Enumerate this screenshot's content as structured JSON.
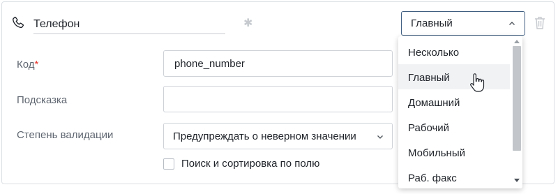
{
  "field": {
    "name_value": "Телефон",
    "type_selected": "Главный"
  },
  "rows": {
    "code": {
      "label": "Код",
      "required_mark": "*",
      "value": "phone_number"
    },
    "hint": {
      "label": "Подсказка",
      "value": ""
    },
    "validation": {
      "label": "Степень валидации",
      "selected": "Предупреждать о неверном значении"
    },
    "search": {
      "label": "Поиск и сортировка по полю",
      "checked": false
    }
  },
  "dropdown": {
    "items": [
      "Несколько",
      "Главный",
      "Домашний",
      "Рабочий",
      "Мобильный",
      "Раб. факс"
    ],
    "hovered_index": 1
  },
  "icons": {
    "phone": "phone-icon",
    "trash": "trash-icon",
    "chevron": "chevron-down-icon",
    "cursor": "hand-pointer-cursor"
  },
  "colors": {
    "required": "#e8392f",
    "select_border_active": "#3f5e80",
    "hover_bg": "#f1f2f4"
  }
}
